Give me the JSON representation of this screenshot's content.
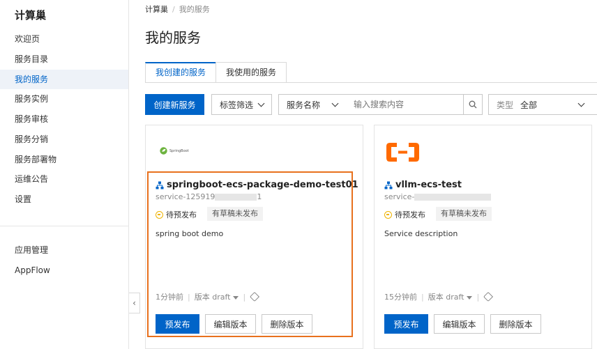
{
  "sidebar": {
    "brand": "计算巢",
    "items": [
      "欢迎页",
      "服务目录",
      "我的服务",
      "服务实例",
      "服务审核",
      "服务分销",
      "服务部署物",
      "运维公告",
      "设置"
    ],
    "bottom_items": [
      "应用管理",
      "AppFlow"
    ],
    "active_index": 2
  },
  "breadcrumb": {
    "root": "计算巢",
    "sep": "/",
    "current": "我的服务"
  },
  "page": {
    "title": "我的服务"
  },
  "tabs": [
    {
      "label": "我创建的服务",
      "active": true
    },
    {
      "label": "我使用的服务",
      "active": false
    }
  ],
  "toolbar": {
    "create_label": "创建新服务",
    "tag_filter_label": "标签筛选",
    "field_select": "服务名称",
    "search_placeholder": "输入搜索内容",
    "type_label": "类型",
    "type_value": "全部"
  },
  "cards": [
    {
      "logo_text": "SpringBoot",
      "name": "springboot-ecs-package-demo-test01",
      "id_prefix": "service-125919",
      "id_suffix": "1",
      "status": "待预发布",
      "draft_tag": "有草稿未发布",
      "description": "spring boot demo",
      "time": "1分钟前",
      "version": "版本 draft",
      "buttons": [
        "预发布",
        "编辑版本",
        "删除版本"
      ]
    },
    {
      "name": "vllm-ecs-test",
      "id_prefix": "service-",
      "id_suffix": "",
      "status": "待预发布",
      "draft_tag": "有草稿未发布",
      "description": "Service description",
      "time": "15分钟前",
      "version": "版本 draft",
      "buttons": [
        "预发布",
        "编辑版本",
        "删除版本"
      ]
    }
  ],
  "colors": {
    "primary": "#0064c8",
    "highlight": "#e8711d",
    "aliyun": "#ff6a00",
    "springboot": "#6db33f",
    "pending": "#f0b400"
  }
}
